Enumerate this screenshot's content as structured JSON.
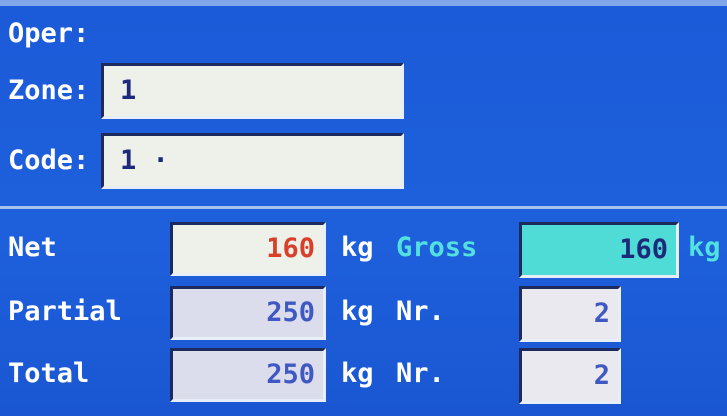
{
  "top": {
    "oper_label": "Oper:",
    "zone_label": "Zone:",
    "zone_value": "1",
    "code_label": "Code:",
    "code_value": "1 ·"
  },
  "weights": {
    "net_label": "Net",
    "net_value": "160",
    "net_unit": "kg",
    "gross_label": "Gross",
    "gross_value": "160",
    "gross_unit": "kg",
    "partial_label": "Partial",
    "partial_value": "250",
    "partial_unit": "kg",
    "partial_nr_label": "Nr.",
    "partial_nr_value": "2",
    "total_label": "Total",
    "total_value": "250",
    "total_unit": "kg",
    "total_nr_label": "Nr.",
    "total_nr_value": "2"
  },
  "colors": {
    "background": "#1b5ad8",
    "net_value": "#d8402a",
    "gross_field": "#4fdcd6",
    "gross_text": "#53e0e0",
    "partial_total_values": "#3f58c2"
  }
}
